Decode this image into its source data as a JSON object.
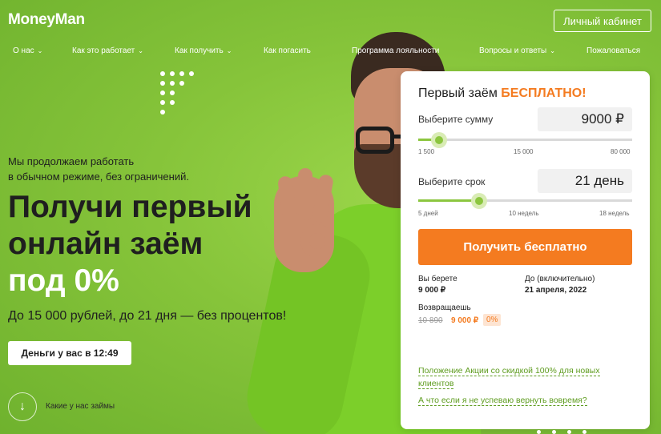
{
  "header": {
    "logo": "MoneyMan",
    "cabinet_button": "Личный кабинет"
  },
  "nav": {
    "items": [
      {
        "label": "О нас",
        "dropdown": true
      },
      {
        "label": "Как это работает",
        "dropdown": true
      },
      {
        "label": "Как получить",
        "dropdown": true
      },
      {
        "label": "Как погасить",
        "dropdown": false
      },
      {
        "label": "Программа лояльности",
        "dropdown": false
      },
      {
        "label": "Вопросы и ответы",
        "dropdown": true
      },
      {
        "label": "Пожаловаться",
        "dropdown": false
      }
    ]
  },
  "hero": {
    "subtitle_line1": "Мы продолжаем работать",
    "subtitle_line2": "в обычном режиме, без ограничений.",
    "title_line1": "Получи первый",
    "title_line2": "онлайн заём",
    "title_line3": "под 0%",
    "description": "До 15 000 рублей, до 21 дня — без процентов!",
    "money_button": "Деньги у вас в 12:49",
    "loans_link": "Какие у нас займы"
  },
  "calculator": {
    "title": "Первый заём",
    "title_accent": "БЕСПЛАТНО!",
    "amount": {
      "label": "Выберите сумму",
      "value": "9000 ₽",
      "fraction": 0.097,
      "ticks": [
        "1 500",
        "15 000",
        "80 000"
      ]
    },
    "term": {
      "label": "Выберите срок",
      "value": "21 день",
      "fraction": 0.283,
      "ticks": [
        "5 дней",
        "10 недель",
        "18 недель"
      ]
    },
    "submit_button": "Получить бесплатно",
    "take_label": "Вы берете",
    "take_value": "9 000 ₽",
    "until_label": "До (включительно)",
    "until_value": "21 апреля, 2022",
    "return_label": "Возвращаешь",
    "return_old": "10 890",
    "return_new": "9 000 ₽",
    "return_percent": "0%",
    "promo_link": "Положение Акции со скидкой 100% для новых клиентов",
    "late_link": "А что если я не успеваю вернуть вовремя?"
  },
  "colors": {
    "brand_green": "#8cc63f",
    "accent_orange": "#f47b20"
  }
}
